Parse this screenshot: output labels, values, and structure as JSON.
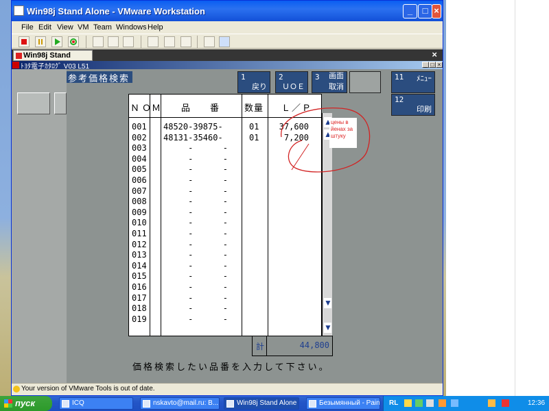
{
  "vmware": {
    "title": "Win98j Stand Alone - VMware Workstation",
    "menu": [
      "File",
      "Edit",
      "View",
      "VM",
      "Team",
      "Windows",
      "Help"
    ],
    "tab_label": "Win98j Stand Alone",
    "tab_close": "×",
    "status_text": "Your version of VMware Tools is out of date.",
    "window_buttons": {
      "min": "_",
      "max": "□",
      "close": "×"
    }
  },
  "guest_window": {
    "title": "ﾄﾖﾀ電子ｶﾀﾛｸﾞ V03 L51",
    "buttons": {
      "min": "_",
      "max": "□",
      "close": "×"
    }
  },
  "app": {
    "header_title": "参考価格検索",
    "fkeys": [
      {
        "num": "1",
        "label": "戻り"
      },
      {
        "num": "2",
        "label": "ＵＯＥ"
      },
      {
        "num": "3",
        "label": "画面取消",
        "label_top": "画面",
        "label_bottom": "取消"
      },
      {
        "num": "11",
        "label": "ﾒﾆｭｰ"
      },
      {
        "num": "12",
        "label": "印刷"
      }
    ],
    "columns": {
      "no": "ＮＯ",
      "m": "Ｍ",
      "part": "品　番",
      "qty": "数量",
      "lp": "Ｌ／Ｐ"
    },
    "rows": [
      {
        "no": "001",
        "part": "48520-39875-",
        "qty": "01",
        "lp": "37,600"
      },
      {
        "no": "002",
        "part": "48131-35460-",
        "qty": "01",
        "lp": "7,200"
      },
      {
        "no": "003",
        "part": "     -      -",
        "qty": "",
        "lp": ""
      },
      {
        "no": "004",
        "part": "     -      -",
        "qty": "",
        "lp": ""
      },
      {
        "no": "005",
        "part": "     -      -",
        "qty": "",
        "lp": ""
      },
      {
        "no": "006",
        "part": "     -      -",
        "qty": "",
        "lp": ""
      },
      {
        "no": "007",
        "part": "     -      -",
        "qty": "",
        "lp": ""
      },
      {
        "no": "008",
        "part": "     -      -",
        "qty": "",
        "lp": ""
      },
      {
        "no": "009",
        "part": "     -      -",
        "qty": "",
        "lp": ""
      },
      {
        "no": "010",
        "part": "     -      -",
        "qty": "",
        "lp": ""
      },
      {
        "no": "011",
        "part": "     -      -",
        "qty": "",
        "lp": ""
      },
      {
        "no": "012",
        "part": "     -      -",
        "qty": "",
        "lp": ""
      },
      {
        "no": "013",
        "part": "     -      -",
        "qty": "",
        "lp": ""
      },
      {
        "no": "014",
        "part": "     -      -",
        "qty": "",
        "lp": ""
      },
      {
        "no": "015",
        "part": "     -      -",
        "qty": "",
        "lp": ""
      },
      {
        "no": "016",
        "part": "     -      -",
        "qty": "",
        "lp": ""
      },
      {
        "no": "017",
        "part": "     -      -",
        "qty": "",
        "lp": ""
      },
      {
        "no": "018",
        "part": "     -      -",
        "qty": "",
        "lp": ""
      },
      {
        "no": "019",
        "part": "     -      -",
        "qty": "",
        "lp": ""
      }
    ],
    "total_label": "計",
    "total_value": "44,800",
    "message": "価格検索したい品番を入力して下さい。",
    "annotation": "цены в йенах за штуку"
  },
  "taskbar": {
    "start": "пуск",
    "items": [
      "ICQ",
      "nskavto@mail.ru: В...",
      "Win98j Stand Alone ...",
      "Безымянный - Paint"
    ],
    "lang": "RL",
    "clock": "12:36"
  },
  "colors": {
    "accent_red": "#d22222",
    "scroll_arrow": "#1f3f8f",
    "header_blue": "#2b4d7f"
  }
}
